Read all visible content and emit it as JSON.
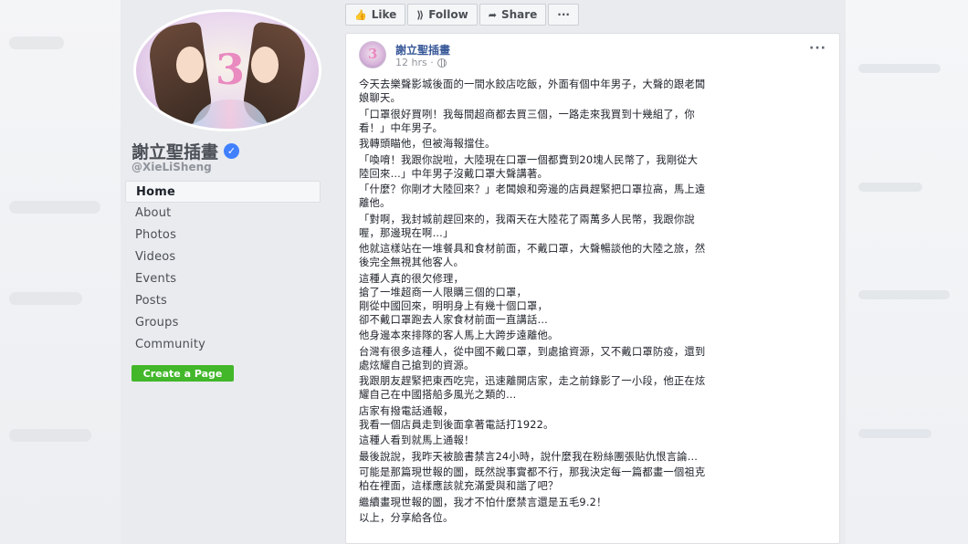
{
  "page": {
    "name": "謝立聖插畫",
    "handle": "@XieLiSheng",
    "nav": [
      "Home",
      "About",
      "Photos",
      "Videos",
      "Events",
      "Posts",
      "Groups",
      "Community"
    ],
    "create_page_label": "Create a Page",
    "cover_icon": "illustration-two-girls-number-3"
  },
  "actions": {
    "like": "Like",
    "follow": "Follow",
    "share": "Share",
    "more": "···"
  },
  "post": {
    "author": "謝立聖插畫",
    "time": "12 hrs ·",
    "menu": "···",
    "paragraphs": [
      [
        "今天去樂聲影城後面的一間水餃店吃飯，外面有個中年男子，大聲的跟老闆",
        "娘聊天。"
      ],
      [
        "「口罩很好買咧！我每間超商都去買三個，一路走來我買到十幾組了，你",
        "看！」中年男子。"
      ],
      [
        "我轉頭瞄他，但被海報擋住。"
      ],
      [
        "「喚唷！我跟你說啦，大陸現在口罩一個都賣到20塊人民幣了，我剛從大",
        "陸回來…」中年男子沒戴口罩大聲講著。"
      ],
      [
        "「什麼？你剛才大陸回來？」老闆娘和旁邊的店員趕緊把口罩拉高，馬上遠",
        "離他。"
      ],
      [
        "「對啊，我封城前趕回來的，我兩天在大陸花了兩萬多人民幣，我跟你說",
        "喔，那邊現在啊…」"
      ],
      [
        "他就這樣站在一堆餐具和食材前面，不戴口罩，大聲暢談他的大陸之旅，然",
        "後完全無視其他客人。"
      ],
      [
        "這種人真的很欠修理，",
        "搶了一堆超商一人限購三個的口罩，",
        "剛從中國回來，明明身上有幾十個口罩，",
        "卻不戴口罩跑去人家食材前面一直講話…"
      ],
      [
        "他身邊本來排隊的客人馬上大跨步遠離他。"
      ],
      [
        "台灣有很多這種人，從中國不戴口罩，到處搶資源，又不戴口罩防疫，還到",
        "處炫耀自己搶到的資源。"
      ],
      [
        "我跟朋友趕緊把東西吃完，迅速離開店家，走之前錄影了一小段，他正在炫",
        "耀自己在中國搭船多風光之類的…"
      ],
      [
        "店家有撥電話通報，",
        "我看一個店員走到後面拿著電話打1922。"
      ],
      [
        "這種人看到就馬上通報！"
      ],
      [
        "最後說說，我昨天被臉書禁言24小時，說什麼我在粉絲團張貼仇恨言論…"
      ],
      [
        "可能是那篇現世報的圖，既然說事實都不行，那我決定每一篇都畫一個祖克",
        "柏在裡面，這樣應該就充滿愛與和諧了吧？"
      ],
      [
        "繼續畫現世報的圖，我才不怕什麼禁言還是五毛9.2！"
      ],
      [
        "以上，分享給各位。"
      ]
    ]
  }
}
